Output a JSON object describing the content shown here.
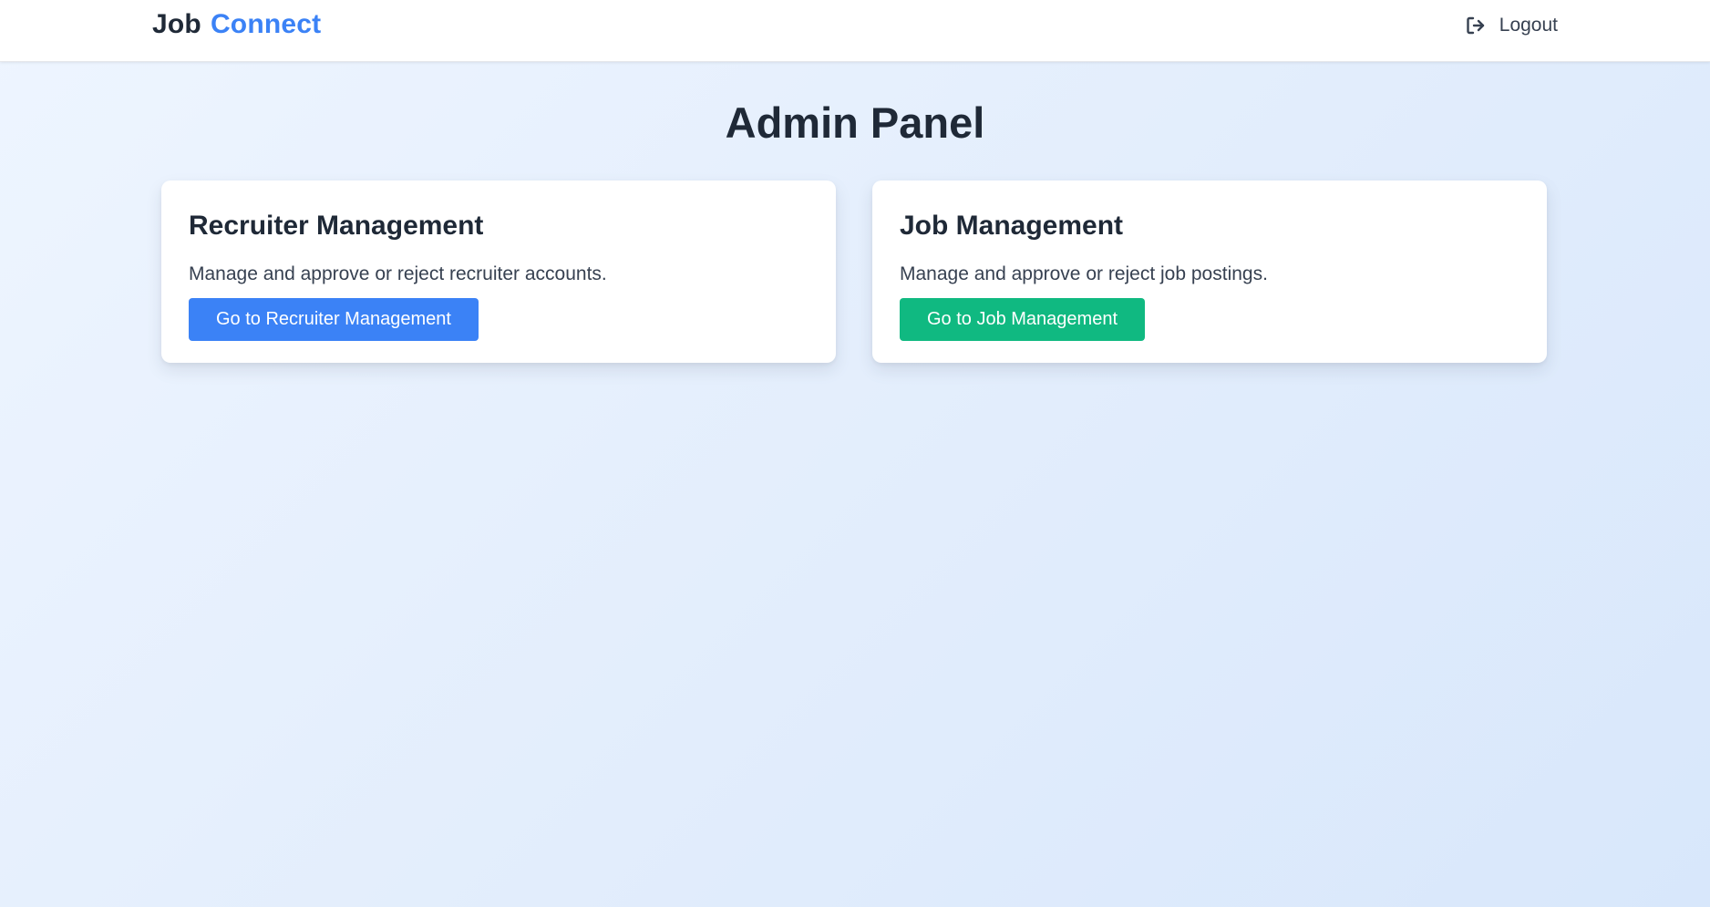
{
  "navbar": {
    "brand_part1": "Job",
    "brand_part2": "Connect",
    "logout_label": "Logout",
    "logout_icon": "sign-out-icon"
  },
  "page": {
    "title": "Admin Panel"
  },
  "cards": [
    {
      "title": "Recruiter Management",
      "description": "Manage and approve or reject recruiter accounts.",
      "button_label": "Go to Recruiter Management",
      "button_color": "#3b82f6"
    },
    {
      "title": "Job Management",
      "description": "Manage and approve or reject job postings.",
      "button_label": "Go to Job Management",
      "button_color": "#10b981"
    }
  ],
  "colors": {
    "brand_accent": "#3b82f6",
    "text_dark": "#1f2937",
    "success": "#10b981"
  }
}
